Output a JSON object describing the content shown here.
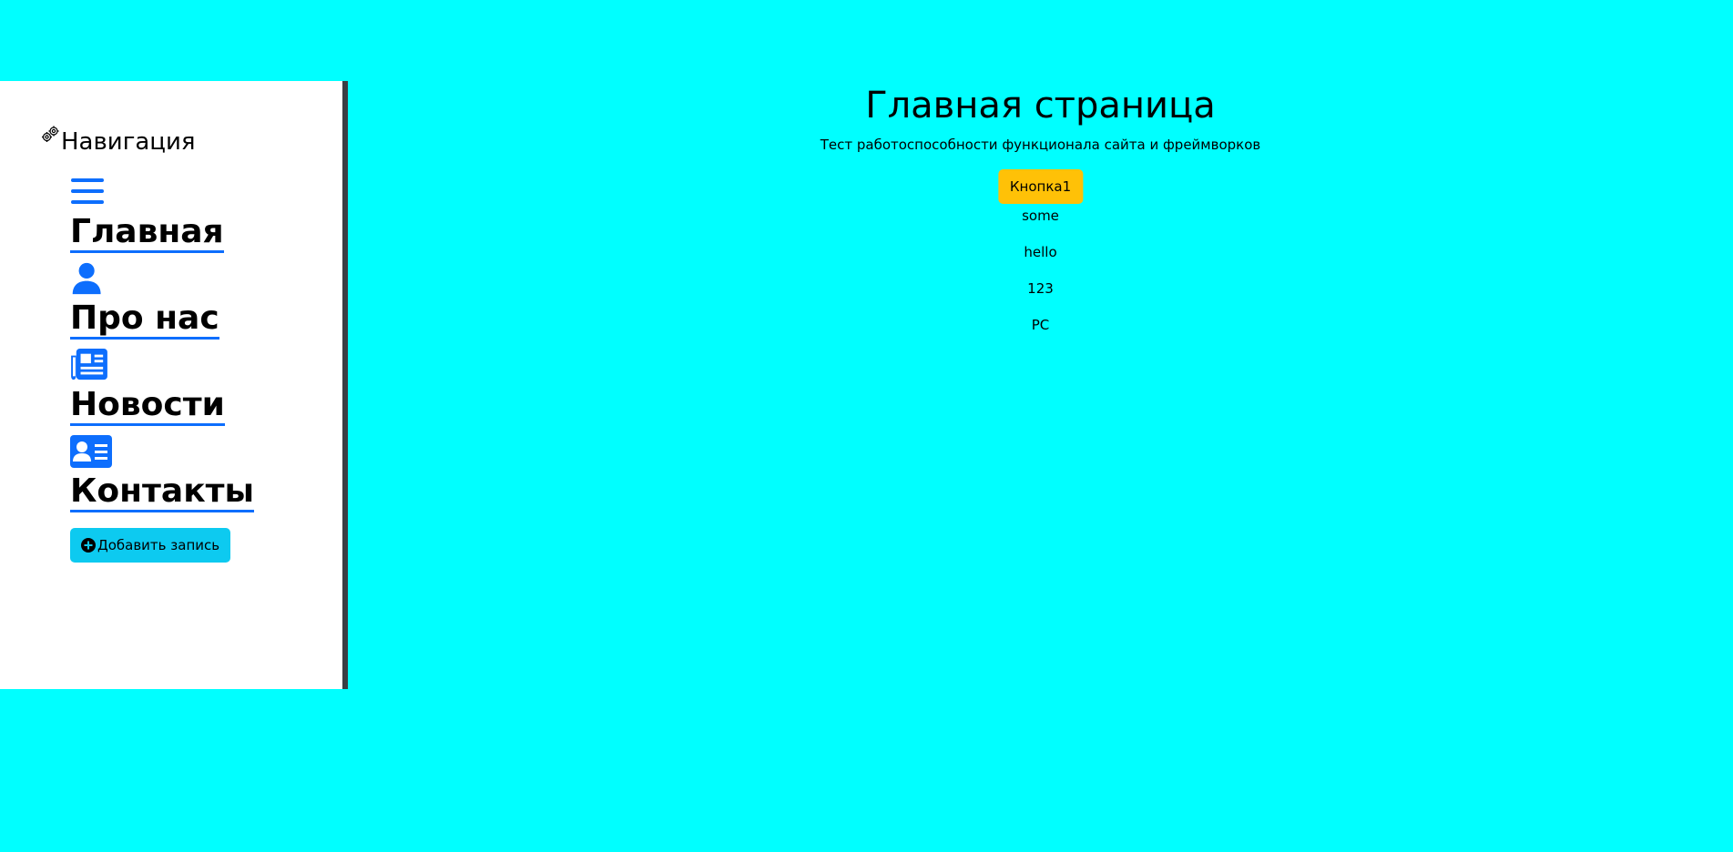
{
  "sidebar": {
    "heading": "Навигация",
    "heading_icon": "gears-icon",
    "items": [
      {
        "label": "Главная",
        "icon": "hamburger-menu-icon"
      },
      {
        "label": "Про нас",
        "icon": "person-icon"
      },
      {
        "label": "Новости",
        "icon": "newspaper-icon"
      },
      {
        "label": "Контакты",
        "icon": "person-vcard-icon"
      }
    ],
    "add_button": {
      "label": "Добавить запись",
      "icon": "plus-circle-icon"
    }
  },
  "main": {
    "title": "Главная страница",
    "subtitle": "Тест работоспособности функционала сайта и фреймворков",
    "button_label": "Кнопка1",
    "items": [
      "some",
      "hello",
      "123",
      "PC"
    ]
  },
  "colors": {
    "page_background": "#00ffff",
    "sidebar_background": "#ffffff",
    "sidebar_border": "#3a3f44",
    "accent": "#0d6efd",
    "info_button": "#0dcaf0",
    "warning_button": "#ffc107"
  }
}
